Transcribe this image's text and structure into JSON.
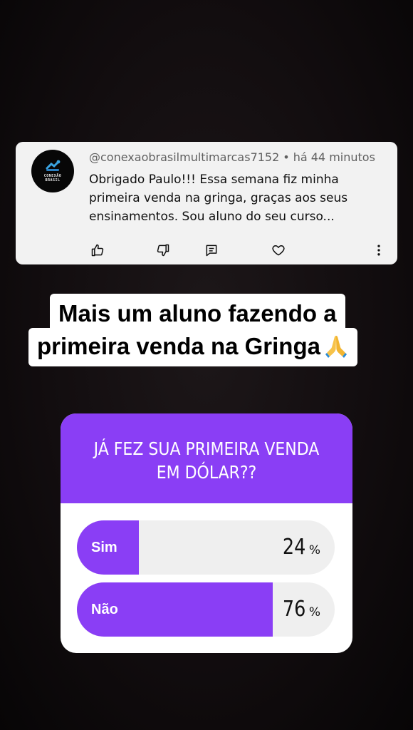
{
  "comment": {
    "username": "@conexaobrasilmultimarcas7152",
    "separator": "•",
    "time": "há 44 minutos",
    "text": "Obrigado Paulo!!! Essa semana fiz minha primeira venda na gringa, graças aos seus ensinamentos. Sou aluno do seu curso...",
    "avatar_text": "CONEXÃO\nBRASIL",
    "actions": [
      "thumbs-up-icon",
      "thumbs-down-icon",
      "reply-icon",
      "heart-icon",
      "more-vert-icon"
    ]
  },
  "caption": {
    "line1": "Mais um aluno fazendo a",
    "line2": "primeira venda na Gringa"
  },
  "poll": {
    "question": "JÁ FEZ SUA PRIMEIRA VENDA EM DÓLAR??",
    "options": [
      {
        "label": "Sim",
        "percent": 24,
        "percent_text": "24"
      },
      {
        "label": "Não",
        "percent": 76,
        "percent_text": "76"
      }
    ],
    "percent_sign": "%",
    "accent_color": "#8a3ef5"
  }
}
